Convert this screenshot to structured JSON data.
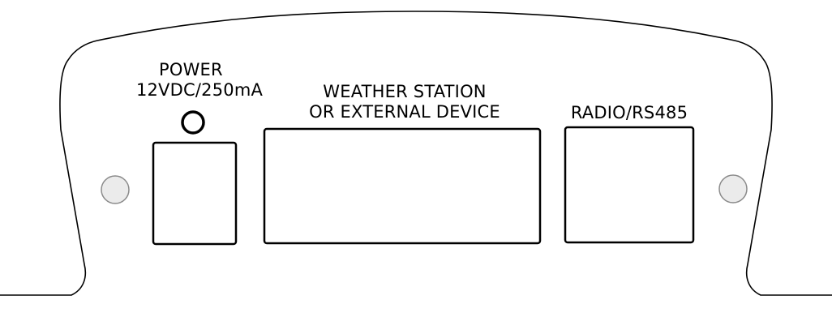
{
  "panel": {
    "power": {
      "title": "POWER",
      "rating": "12VDC/250mA"
    },
    "weather_station": {
      "line1": "WEATHER STATION",
      "line2": "OR EXTERNAL DEVICE"
    },
    "radio": {
      "label": "RADIO/RS485"
    }
  },
  "colors": {
    "outline": "#000000",
    "hole_fill": "#ebebeb",
    "hole_stroke": "#8a8a8a",
    "background": "#ffffff"
  }
}
